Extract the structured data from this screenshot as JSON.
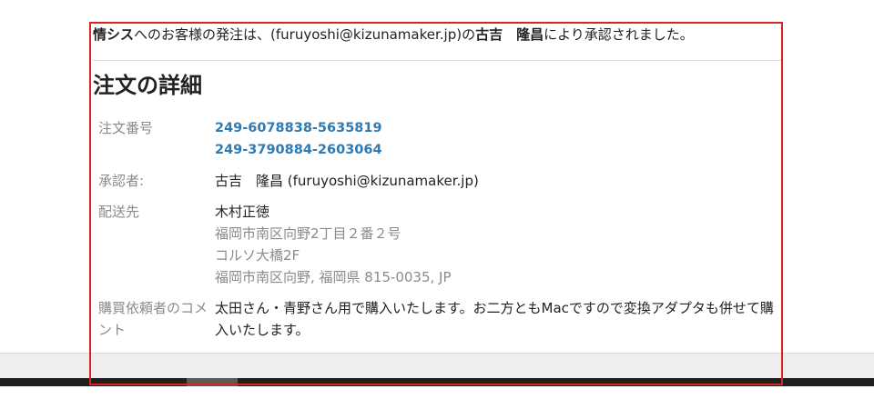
{
  "intro": {
    "part1_bold": "情シス",
    "part2": "へのお客様の発注は、(furuyoshi@kizunamaker.jp)の",
    "part3_bold": "古吉　隆昌",
    "part4": "により承認されました。"
  },
  "details": {
    "title": "注文の詳細",
    "order_numbers_label": "注文番号",
    "order_numbers": [
      "249-6078838-5635819",
      "249-3790884-2603064"
    ],
    "approver_label": "承認者:",
    "approver": "古吉　隆昌 (furuyoshi@kizunamaker.jp)",
    "shipping_label": "配送先",
    "shipping": {
      "name": "木村正徳",
      "line1": "福岡市南区向野2丁目２番２号",
      "line2": "コルソ大橋2F",
      "line3": "福岡市南区向野, 福岡県 815-0035, JP"
    },
    "comment_label": "購買依頼者のコメント",
    "comment": "太田さん・青野さん用で購入いたします。お二方ともMacですので変換アダプタも併せて購入いたします。"
  },
  "colors": {
    "link": "#2f7ab3",
    "highlight_border": "#d9251d",
    "muted_text": "#8a8a8a"
  }
}
